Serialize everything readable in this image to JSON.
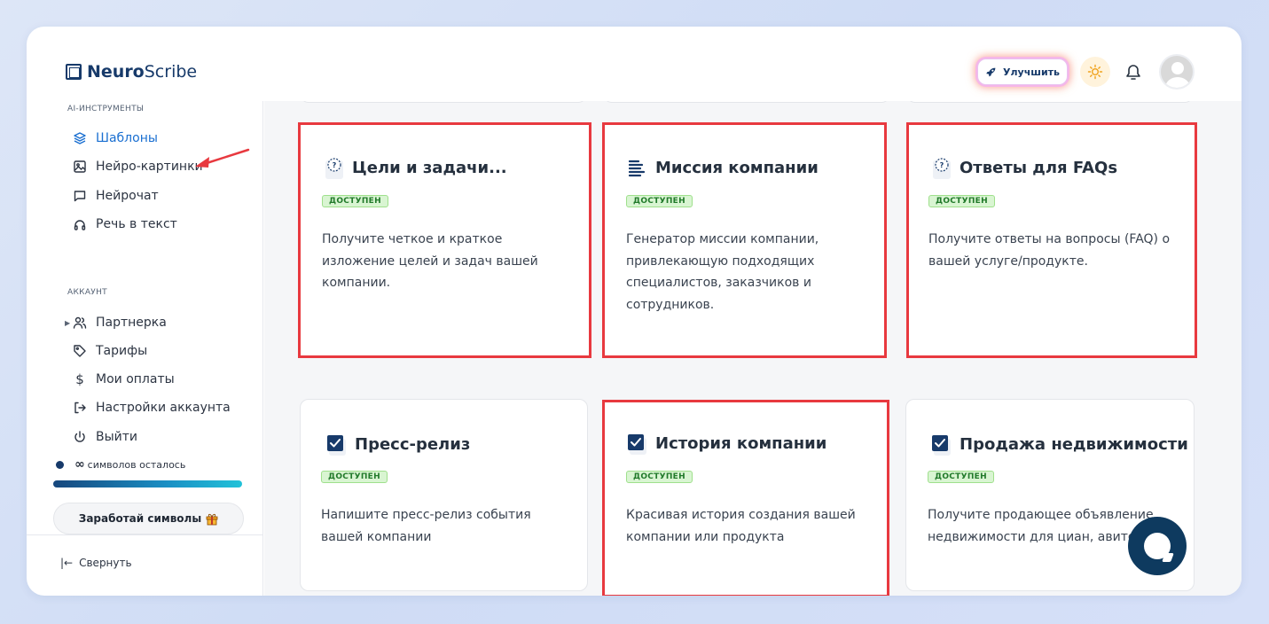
{
  "brand": {
    "name_bold": "Neuro",
    "name_rest": "Scribe"
  },
  "header": {
    "upgrade_label": "Улучшить"
  },
  "sidebar": {
    "ai_section": "AI-ИНСТРУМЕНТЫ",
    "ai_items": [
      {
        "label": "Шаблоны",
        "icon": "layers-icon",
        "active": true
      },
      {
        "label": "Нейро-картинки",
        "icon": "image-icon"
      },
      {
        "label": "Нейрочат",
        "icon": "chat-icon"
      },
      {
        "label": "Речь в текст",
        "icon": "headphones-icon"
      }
    ],
    "account_section": "АККАУНТ",
    "account_items": [
      {
        "label": "Партнерка",
        "icon": "users-icon"
      },
      {
        "label": "Тарифы",
        "icon": "tag-icon"
      },
      {
        "label": "Мои оплаты",
        "icon": "dollar-icon"
      },
      {
        "label": "Настройки аккаунта",
        "icon": "logout-arrow-icon"
      },
      {
        "label": "Выйти",
        "icon": "power-icon"
      }
    ],
    "credits_symbol": "∞",
    "credits_text": "символов осталось",
    "credits_progress": 1.0,
    "earn_label": "Заработай символы",
    "collapse_label": "Свернуть"
  },
  "cards": [
    {
      "title": "Цели и задачи...",
      "badge": "ДОСТУПЕН",
      "desc": "Получите четкое и краткое изложение целей и задач вашей компании.",
      "icon": "clipboard-question-icon",
      "highlighted": true
    },
    {
      "title": "Миссия компании",
      "badge": "ДОСТУПЕН",
      "desc": "Генератор миссии компании, привлекающую подходящих специалистов, заказчиков и сотрудников.",
      "icon": "list-lines-icon",
      "highlighted": true
    },
    {
      "title": "Ответы для FAQs",
      "badge": "ДОСТУПЕН",
      "desc": "Получите ответы на вопросы (FAQ) о вашей услуге/продукте.",
      "icon": "clipboard-question-icon",
      "highlighted": true
    },
    {
      "title": "Пресс-релиз",
      "badge": "ДОСТУПЕН",
      "desc": "Напишите пресс-релиз события вашей компании",
      "icon": "checkbox-icon",
      "highlighted": false
    },
    {
      "title": "История компании",
      "badge": "ДОСТУПЕН",
      "desc": "Красивая история создания вашей компании или продукта",
      "icon": "checkbox-icon",
      "highlighted": true
    },
    {
      "title": "Продажа недвижимости",
      "badge": "ДОСТУПЕН",
      "desc": "Получите продающее объявление недвижимости для циан, авито и др.",
      "icon": "checkbox-icon",
      "highlighted": false
    }
  ],
  "colors": {
    "brand": "#173a6a",
    "active": "#1a6fd1",
    "highlight": "#e8393f",
    "badge_bg": "#d9f5d2",
    "chat": "#0e3a5f"
  }
}
